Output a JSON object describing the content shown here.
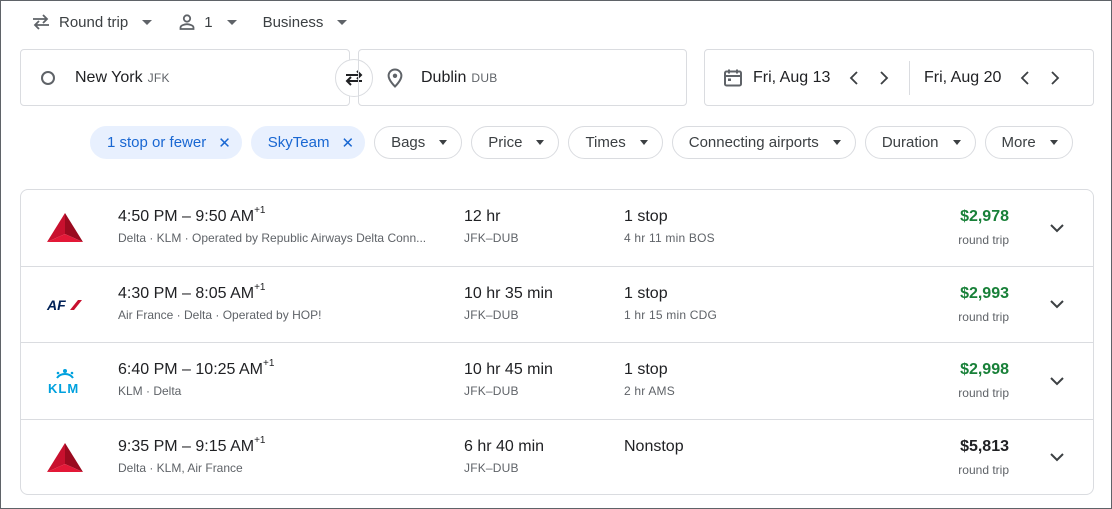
{
  "topbar": {
    "trip_type": "Round trip",
    "passengers": "1",
    "cabin": "Business"
  },
  "search": {
    "origin_city": "New York",
    "origin_code": "JFK",
    "destination_city": "Dublin",
    "destination_code": "DUB",
    "depart_date": "Fri, Aug 13",
    "return_date": "Fri, Aug 20"
  },
  "filters": {
    "active": [
      "1 stop or fewer",
      "SkyTeam"
    ],
    "dropdowns": [
      "Bags",
      "Price",
      "Times",
      "Connecting airports",
      "Duration",
      "More"
    ]
  },
  "flights": [
    {
      "logo": "delta-logo",
      "depart": "4:50 PM",
      "arrive": "9:50 AM",
      "day_offset": "+1",
      "airlines": "Delta · KLM · Operated by Republic Airways Delta Conn...",
      "duration": "12 hr",
      "route": "JFK–DUB",
      "stops": "1 stop",
      "layover": "4 hr 11 min BOS",
      "price": "$2,978",
      "price_type": "round trip",
      "highlight": true
    },
    {
      "logo": "airfrance-logo",
      "depart": "4:30 PM",
      "arrive": "8:05 AM",
      "day_offset": "+1",
      "airlines": "Air France · Delta · Operated by HOP!",
      "duration": "10 hr 35 min",
      "route": "JFK–DUB",
      "stops": "1 stop",
      "layover": "1 hr 15 min CDG",
      "price": "$2,993",
      "price_type": "round trip",
      "highlight": true
    },
    {
      "logo": "klm-logo",
      "depart": "6:40 PM",
      "arrive": "10:25 AM",
      "day_offset": "+1",
      "airlines": "KLM · Delta",
      "duration": "10 hr 45 min",
      "route": "JFK–DUB",
      "stops": "1 stop",
      "layover": "2 hr AMS",
      "price": "$2,998",
      "price_type": "round trip",
      "highlight": true
    },
    {
      "logo": "delta-logo",
      "depart": "9:35 PM",
      "arrive": "9:15 AM",
      "day_offset": "+1",
      "airlines": "Delta · KLM, Air France",
      "duration": "6 hr 40 min",
      "route": "JFK–DUB",
      "stops": "Nonstop",
      "layover": "",
      "price": "$5,813",
      "price_type": "round trip",
      "highlight": false
    }
  ],
  "colors": {
    "accent": "#1967d2",
    "accent_bg": "#e8f0fe",
    "good_price": "#188038",
    "delta_red": "#c8102e",
    "airfrance_blue": "#002157",
    "klm_blue": "#00a1de"
  }
}
